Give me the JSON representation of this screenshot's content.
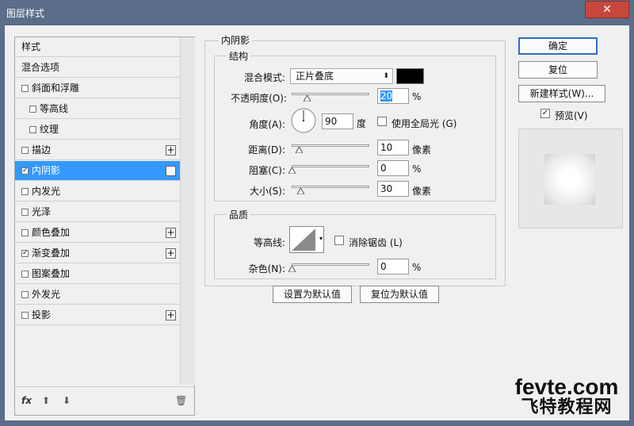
{
  "window": {
    "title": "图层样式",
    "close": "✕"
  },
  "list": {
    "items": [
      {
        "label": "样式",
        "checkbox": false,
        "checked": false,
        "plus": false,
        "indent": 0,
        "selected": false
      },
      {
        "label": "混合选项",
        "checkbox": false,
        "checked": false,
        "plus": false,
        "indent": 0,
        "selected": false
      },
      {
        "label": "斜面和浮雕",
        "checkbox": true,
        "checked": false,
        "plus": false,
        "indent": 0,
        "selected": false
      },
      {
        "label": "等高线",
        "checkbox": true,
        "checked": false,
        "plus": false,
        "indent": 1,
        "selected": false
      },
      {
        "label": "纹理",
        "checkbox": true,
        "checked": false,
        "plus": false,
        "indent": 1,
        "selected": false
      },
      {
        "label": "描边",
        "checkbox": true,
        "checked": false,
        "plus": true,
        "indent": 0,
        "selected": false
      },
      {
        "label": "内阴影",
        "checkbox": true,
        "checked": true,
        "plus": true,
        "indent": 0,
        "selected": true
      },
      {
        "label": "内发光",
        "checkbox": true,
        "checked": false,
        "plus": false,
        "indent": 0,
        "selected": false
      },
      {
        "label": "光泽",
        "checkbox": true,
        "checked": false,
        "plus": false,
        "indent": 0,
        "selected": false
      },
      {
        "label": "颜色叠加",
        "checkbox": true,
        "checked": false,
        "plus": true,
        "indent": 0,
        "selected": false
      },
      {
        "label": "渐变叠加",
        "checkbox": true,
        "checked": true,
        "plus": true,
        "indent": 0,
        "selected": false
      },
      {
        "label": "图案叠加",
        "checkbox": true,
        "checked": false,
        "plus": false,
        "indent": 0,
        "selected": false
      },
      {
        "label": "外发光",
        "checkbox": true,
        "checked": false,
        "plus": false,
        "indent": 0,
        "selected": false
      },
      {
        "label": "投影",
        "checkbox": true,
        "checked": false,
        "plus": true,
        "indent": 0,
        "selected": false
      }
    ],
    "footer": {
      "fx": "fx",
      "up": "⬆",
      "down": "⬇",
      "trash": "🗑"
    }
  },
  "panel": {
    "title": "内阴影",
    "structure": {
      "title": "结构",
      "blend_label": "混合模式:",
      "blend_value": "正片叠底",
      "swatch_color": "#000000",
      "opacity_label": "不透明度(O):",
      "opacity_value": "20",
      "opacity_level": 20,
      "percent": "%",
      "angle_label": "角度(A):",
      "angle_value": "90",
      "angle_unit": "度",
      "global_light_label": "使用全局光 (G)",
      "global_light_checked": false,
      "distance_label": "距离(D):",
      "distance_value": "10",
      "distance_level": 10,
      "px_unit": "像素",
      "choke_label": "阻塞(C):",
      "choke_value": "0",
      "choke_level": 0,
      "size_label": "大小(S):",
      "size_value": "30",
      "size_level": 12
    },
    "quality": {
      "title": "品质",
      "contour_label": "等高线:",
      "antialias_label": "消除锯齿 (L)",
      "antialias_checked": false,
      "noise_label": "杂色(N):",
      "noise_value": "0",
      "noise_level": 0,
      "percent": "%"
    },
    "set_default": "设置为默认值",
    "reset_default": "复位为默认值"
  },
  "buttons": {
    "ok": "确定",
    "reset": "复位",
    "new_style": "新建样式(W)...",
    "preview_label": "预览(V)",
    "preview_checked": true
  },
  "watermark": {
    "line1": "fevte.com",
    "line2": "飞特教程网"
  }
}
